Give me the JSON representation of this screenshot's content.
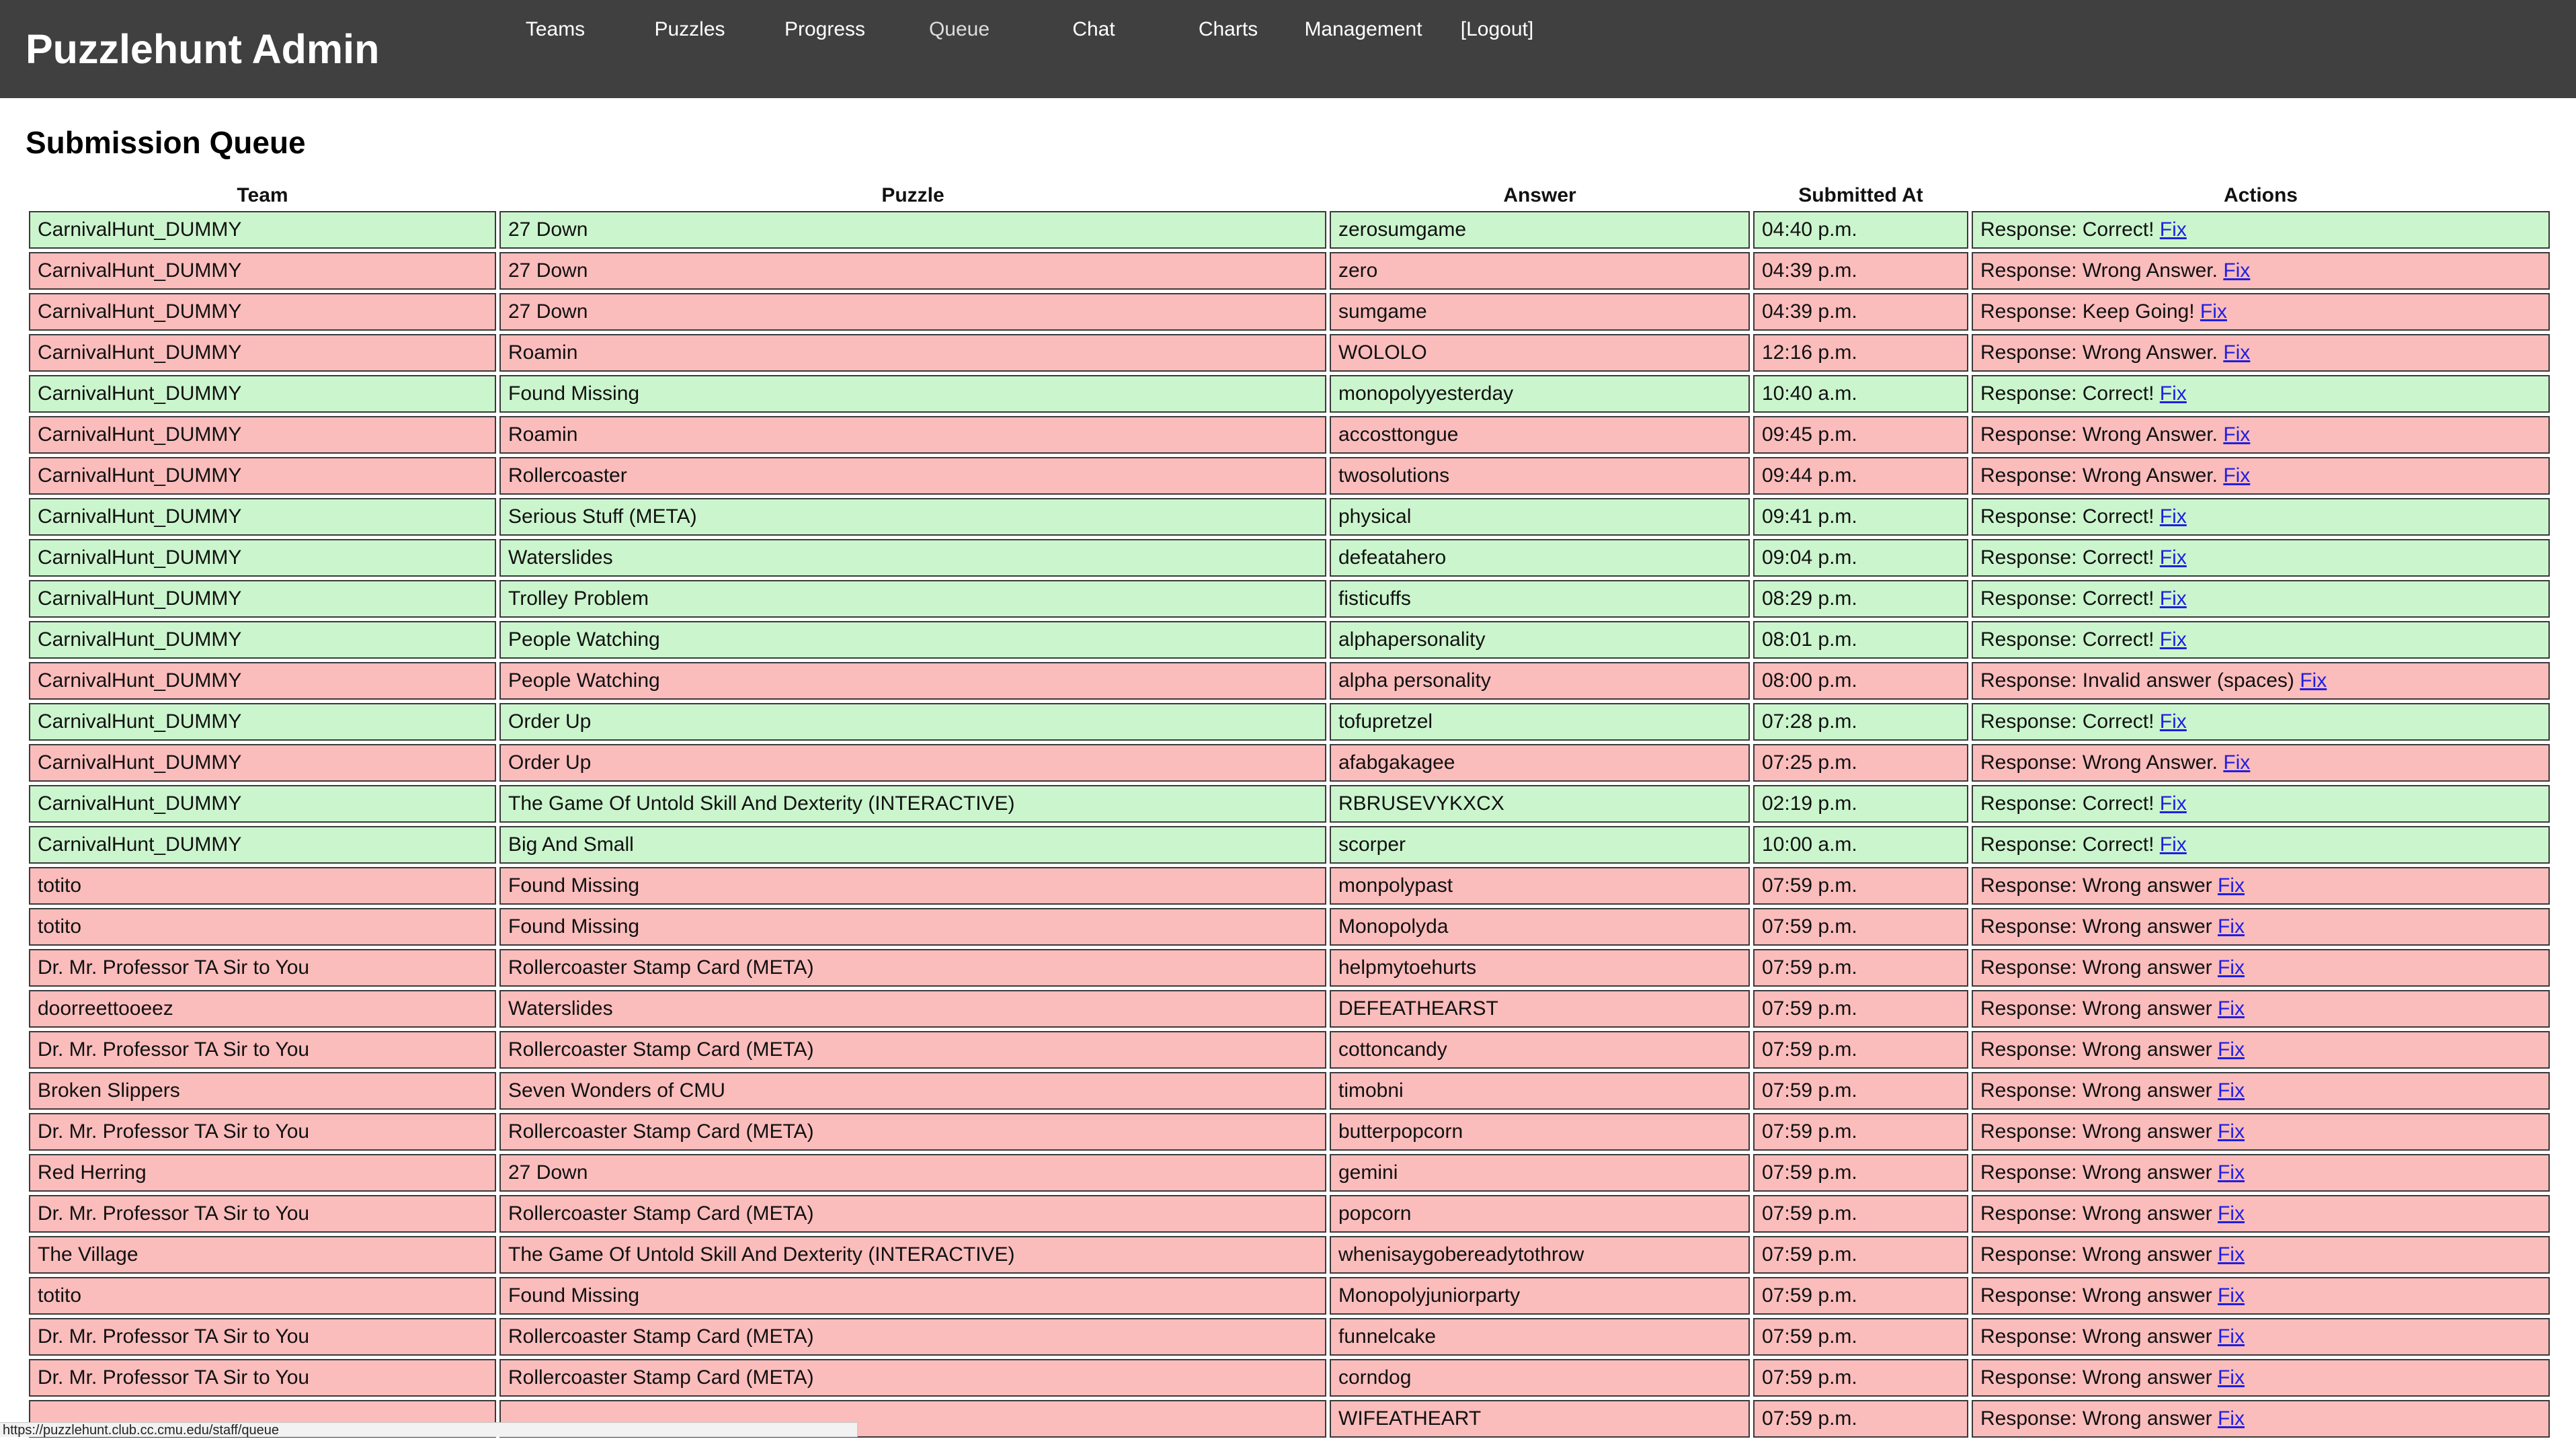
{
  "app": {
    "title": "Puzzlehunt Admin"
  },
  "nav": {
    "items": [
      {
        "label": "Teams"
      },
      {
        "label": "Puzzles"
      },
      {
        "label": "Progress"
      },
      {
        "label": "Queue"
      },
      {
        "label": "Chat"
      },
      {
        "label": "Charts"
      },
      {
        "label": "Management"
      },
      {
        "label": "[Logout]"
      }
    ],
    "current": "Queue"
  },
  "page": {
    "title": "Submission Queue"
  },
  "colors": {
    "header_bg": "#404040",
    "correct_row": "#cbf5cd",
    "wrong_row": "#fbbcbc",
    "link": "#1f1fe0"
  },
  "table": {
    "headers": [
      "Team",
      "Puzzle",
      "Answer",
      "Submitted At",
      "Actions"
    ],
    "fix_label": "Fix",
    "rows": [
      {
        "team": "CarnivalHunt_DUMMY",
        "puzzle": "27 Down",
        "answer": "zerosumgame",
        "time": "04:40 p.m.",
        "response": "Response: Correct!",
        "status": "correct"
      },
      {
        "team": "CarnivalHunt_DUMMY",
        "puzzle": "27 Down",
        "answer": "zero",
        "time": "04:39 p.m.",
        "response": "Response: Wrong Answer.",
        "status": "wrong"
      },
      {
        "team": "CarnivalHunt_DUMMY",
        "puzzle": "27 Down",
        "answer": "sumgame",
        "time": "04:39 p.m.",
        "response": "Response: Keep Going!",
        "status": "wrong"
      },
      {
        "team": "CarnivalHunt_DUMMY",
        "puzzle": "Roamin",
        "answer": "WOLOLO",
        "time": "12:16 p.m.",
        "response": "Response: Wrong Answer.",
        "status": "wrong"
      },
      {
        "team": "CarnivalHunt_DUMMY",
        "puzzle": "Found Missing",
        "answer": "monopolyyesterday",
        "time": "10:40 a.m.",
        "response": "Response: Correct!",
        "status": "correct"
      },
      {
        "team": "CarnivalHunt_DUMMY",
        "puzzle": "Roamin",
        "answer": "accosttongue",
        "time": "09:45 p.m.",
        "response": "Response: Wrong Answer.",
        "status": "wrong"
      },
      {
        "team": "CarnivalHunt_DUMMY",
        "puzzle": "Rollercoaster",
        "answer": "twosolutions",
        "time": "09:44 p.m.",
        "response": "Response: Wrong Answer.",
        "status": "wrong"
      },
      {
        "team": "CarnivalHunt_DUMMY",
        "puzzle": "Serious Stuff (META)",
        "answer": "physical",
        "time": "09:41 p.m.",
        "response": "Response: Correct!",
        "status": "correct"
      },
      {
        "team": "CarnivalHunt_DUMMY",
        "puzzle": "Waterslides",
        "answer": "defeatahero",
        "time": "09:04 p.m.",
        "response": "Response: Correct!",
        "status": "correct"
      },
      {
        "team": "CarnivalHunt_DUMMY",
        "puzzle": "Trolley Problem",
        "answer": "fisticuffs",
        "time": "08:29 p.m.",
        "response": "Response: Correct!",
        "status": "correct"
      },
      {
        "team": "CarnivalHunt_DUMMY",
        "puzzle": "People Watching",
        "answer": "alphapersonality",
        "time": "08:01 p.m.",
        "response": "Response: Correct!",
        "status": "correct"
      },
      {
        "team": "CarnivalHunt_DUMMY",
        "puzzle": "People Watching",
        "answer": "alpha personality",
        "time": "08:00 p.m.",
        "response": "Response: Invalid answer (spaces)",
        "status": "wrong"
      },
      {
        "team": "CarnivalHunt_DUMMY",
        "puzzle": "Order Up",
        "answer": "tofupretzel",
        "time": "07:28 p.m.",
        "response": "Response: Correct!",
        "status": "correct"
      },
      {
        "team": "CarnivalHunt_DUMMY",
        "puzzle": "Order Up",
        "answer": "afabgakagee",
        "time": "07:25 p.m.",
        "response": "Response: Wrong Answer.",
        "status": "wrong"
      },
      {
        "team": "CarnivalHunt_DUMMY",
        "puzzle": "The Game Of Untold Skill And Dexterity (INTERACTIVE)",
        "answer": "RBRUSEVYKXCX",
        "time": "02:19 p.m.",
        "response": "Response: Correct!",
        "status": "correct"
      },
      {
        "team": "CarnivalHunt_DUMMY",
        "puzzle": "Big And Small",
        "answer": "scorper",
        "time": "10:00 a.m.",
        "response": "Response: Correct!",
        "status": "correct"
      },
      {
        "team": "totito",
        "puzzle": "Found Missing",
        "answer": "monpolypast",
        "time": "07:59 p.m.",
        "response": "Response: Wrong answer",
        "status": "wrong"
      },
      {
        "team": "totito",
        "puzzle": "Found Missing",
        "answer": "Monopolyda",
        "time": "07:59 p.m.",
        "response": "Response: Wrong answer",
        "status": "wrong"
      },
      {
        "team": "Dr. Mr. Professor TA Sir to You",
        "puzzle": "Rollercoaster Stamp Card (META)",
        "answer": "helpmytoehurts",
        "time": "07:59 p.m.",
        "response": "Response: Wrong answer",
        "status": "wrong"
      },
      {
        "team": "doorreettooeez",
        "puzzle": "Waterslides",
        "answer": "DEFEATHEARST",
        "time": "07:59 p.m.",
        "response": "Response: Wrong answer",
        "status": "wrong"
      },
      {
        "team": "Dr. Mr. Professor TA Sir to You",
        "puzzle": "Rollercoaster Stamp Card (META)",
        "answer": "cottoncandy",
        "time": "07:59 p.m.",
        "response": "Response: Wrong answer",
        "status": "wrong"
      },
      {
        "team": "Broken Slippers",
        "puzzle": "Seven Wonders of CMU",
        "answer": "timobni",
        "time": "07:59 p.m.",
        "response": "Response: Wrong answer",
        "status": "wrong"
      },
      {
        "team": "Dr. Mr. Professor TA Sir to You",
        "puzzle": "Rollercoaster Stamp Card (META)",
        "answer": "butterpopcorn",
        "time": "07:59 p.m.",
        "response": "Response: Wrong answer",
        "status": "wrong"
      },
      {
        "team": "Red Herring",
        "puzzle": "27 Down",
        "answer": "gemini",
        "time": "07:59 p.m.",
        "response": "Response: Wrong answer",
        "status": "wrong"
      },
      {
        "team": "Dr. Mr. Professor TA Sir to You",
        "puzzle": "Rollercoaster Stamp Card (META)",
        "answer": "popcorn",
        "time": "07:59 p.m.",
        "response": "Response: Wrong answer",
        "status": "wrong"
      },
      {
        "team": "The Village",
        "puzzle": "The Game Of Untold Skill And Dexterity (INTERACTIVE)",
        "answer": "whenisaygobereadytothrow",
        "time": "07:59 p.m.",
        "response": "Response: Wrong answer",
        "status": "wrong"
      },
      {
        "team": "totito",
        "puzzle": "Found Missing",
        "answer": "Monopolyjuniorparty",
        "time": "07:59 p.m.",
        "response": "Response: Wrong answer",
        "status": "wrong"
      },
      {
        "team": "Dr. Mr. Professor TA Sir to You",
        "puzzle": "Rollercoaster Stamp Card (META)",
        "answer": "funnelcake",
        "time": "07:59 p.m.",
        "response": "Response: Wrong answer",
        "status": "wrong"
      },
      {
        "team": "Dr. Mr. Professor TA Sir to You",
        "puzzle": "Rollercoaster Stamp Card (META)",
        "answer": "corndog",
        "time": "07:59 p.m.",
        "response": "Response: Wrong answer",
        "status": "wrong"
      },
      {
        "team": "",
        "puzzle": "",
        "answer": "WIFEATHEART",
        "time": "07:59 p.m.",
        "response": "Response: Wrong answer",
        "status": "wrong"
      }
    ]
  },
  "statusbar": {
    "url": "https://puzzlehunt.club.cc.cmu.edu/staff/queue"
  }
}
